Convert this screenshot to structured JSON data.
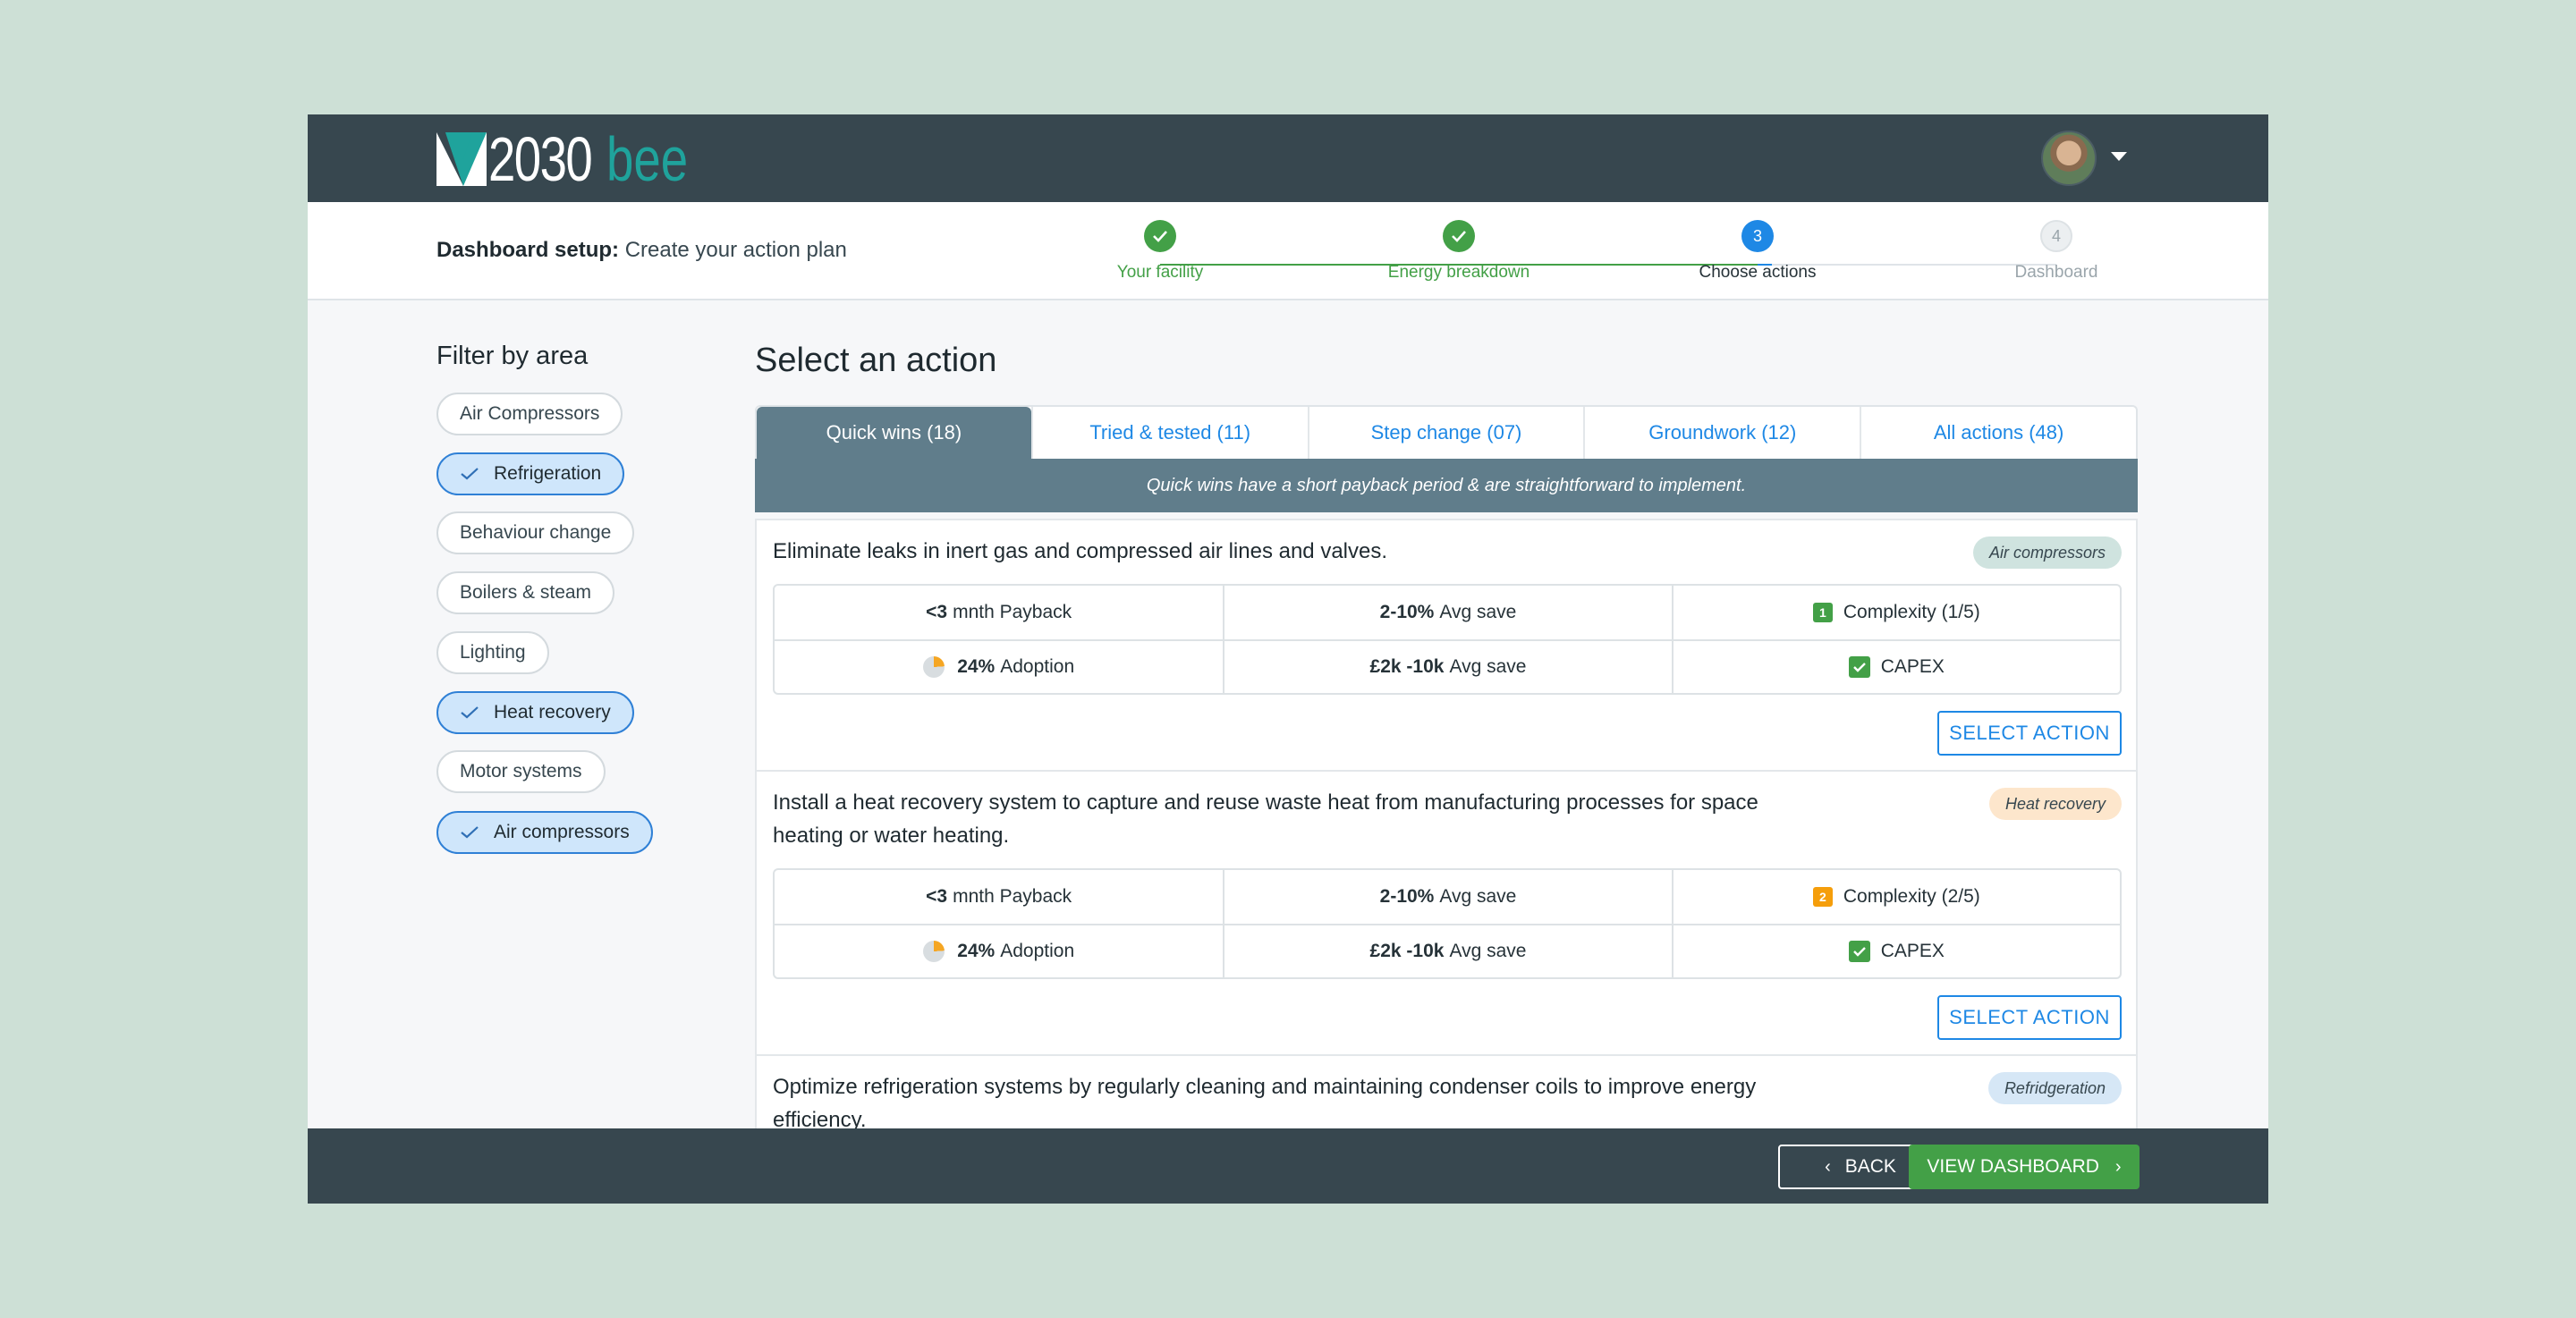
{
  "brand": {
    "number": "2030",
    "name": "bee"
  },
  "setup": {
    "title_bold": "Dashboard setup:",
    "title_rest": " Create your action plan"
  },
  "steps": [
    {
      "label": "Your facility",
      "state": "done",
      "marker": "check"
    },
    {
      "label": "Energy breakdown",
      "state": "done",
      "marker": "check"
    },
    {
      "label": "Choose actions",
      "state": "current",
      "marker": "3"
    },
    {
      "label": "Dashboard",
      "state": "todo",
      "marker": "4"
    }
  ],
  "filter": {
    "title": "Filter by area",
    "chips": [
      {
        "label": "Air Compressors",
        "selected": false
      },
      {
        "label": "Refrigeration",
        "selected": true
      },
      {
        "label": "Behaviour change",
        "selected": false
      },
      {
        "label": "Boilers & steam",
        "selected": false
      },
      {
        "label": "Lighting",
        "selected": false
      },
      {
        "label": "Heat recovery",
        "selected": true
      },
      {
        "label": "Motor systems",
        "selected": false
      },
      {
        "label": "Air compressors",
        "selected": true
      }
    ]
  },
  "main": {
    "title": "Select an action",
    "tabs": [
      {
        "label": "Quick wins (18)",
        "active": true
      },
      {
        "label": "Tried & tested (11)",
        "active": false
      },
      {
        "label": "Step change (07)",
        "active": false
      },
      {
        "label": "Groundwork (12)",
        "active": false
      },
      {
        "label": "All actions (48)",
        "active": false
      }
    ],
    "tab_description": "Quick wins have a short payback period & are straightforward to implement."
  },
  "actions": [
    {
      "title": "Eliminate leaks in inert gas and compressed air lines and valves.",
      "tag": "Air compressors",
      "tag_color": "#cfe3df",
      "payback_value": "<3",
      "payback_label": "mnth Payback",
      "save_pct_value": "2-10%",
      "save_pct_label": "Avg save",
      "complexity_level": "1",
      "complexity_color": "#43a047",
      "complexity_label": "Complexity (1/5)",
      "adoption_value": "24%",
      "adoption_label": "Adoption",
      "save_money_value": "£2k -10k",
      "save_money_label": "Avg save",
      "capex_label": "CAPEX",
      "button": "SELECT ACTION"
    },
    {
      "title": "Install a heat recovery system to capture and reuse waste heat from manufacturing processes for space heating or water heating.",
      "tag": "Heat recovery",
      "tag_color": "#fde6cc",
      "payback_value": "<3",
      "payback_label": "mnth Payback",
      "save_pct_value": "2-10%",
      "save_pct_label": "Avg save",
      "complexity_level": "2",
      "complexity_color": "#f59e0b",
      "complexity_label": "Complexity (2/5)",
      "adoption_value": "24%",
      "adoption_label": "Adoption",
      "save_money_value": "£2k -10k",
      "save_money_label": "Avg save",
      "capex_label": "CAPEX",
      "button": "SELECT ACTION"
    },
    {
      "title": "Optimize refrigeration systems by regularly cleaning and maintaining condenser coils to improve energy efficiency.",
      "tag": "Refridgeration",
      "tag_color": "#d6e7f6"
    }
  ],
  "footer": {
    "back": "BACK",
    "next": "VIEW DASHBOARD"
  },
  "colors": {
    "topbar": "#37474f",
    "accent_green": "#43a047",
    "accent_blue": "#1e88e5",
    "tab_active": "#607d8b"
  }
}
